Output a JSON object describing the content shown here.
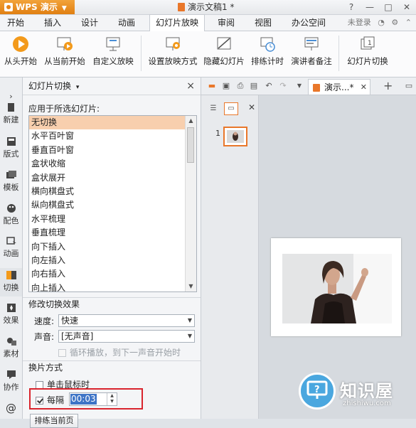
{
  "titlebar": {
    "app_name": "WPS 演示",
    "doc_title": "演示文稿1 *",
    "controls": [
      "?",
      "—",
      "□",
      "✕"
    ]
  },
  "menu": {
    "tabs": [
      "开始",
      "插入",
      "设计",
      "动画",
      "幻灯片放映",
      "审阅",
      "视图",
      "办公空间"
    ],
    "active": "幻灯片放映",
    "login": "未登录"
  },
  "ribbon": {
    "buttons": [
      "从头开始",
      "从当前开始",
      "自定义放映",
      "设置放映方式",
      "隐藏幻灯片",
      "排练计时",
      "演讲者备注",
      "幻灯片切换"
    ]
  },
  "left_toolbar": {
    "items": [
      "新建",
      "版式",
      "模板",
      "配色",
      "动画",
      "切换",
      "效果",
      "素材",
      "协作",
      "@"
    ],
    "active": "切换"
  },
  "pane": {
    "title": "幻灯片切换",
    "apply_label": "应用于所选幻灯片:",
    "transitions": [
      "无切换",
      "水平百叶窗",
      "垂直百叶窗",
      "盒状收缩",
      "盒状展开",
      "横向棋盘式",
      "纵向棋盘式",
      "水平梳理",
      "垂直梳理",
      "向下插入",
      "向左插入",
      "向右插入",
      "向上插入"
    ],
    "selected": "无切换",
    "modify_label": "修改切换效果",
    "speed_label": "速度:",
    "speed_value": "快速",
    "sound_label": "声音:",
    "sound_value": "[无声音]",
    "loop_label": "循环播放，到下一声音开始时",
    "advance_label": "换片方式",
    "on_click_label": "单击鼠标时",
    "every_label": "每隔",
    "every_value": "00:03",
    "partial_button": "排练当前页"
  },
  "doc_tab": {
    "label": "演示...*"
  },
  "thumbnails": {
    "slide_number": "1"
  },
  "watermark": {
    "title": "知识屋",
    "subtitle": "zhishiwu.com"
  },
  "colors": {
    "accent": "#e9772a",
    "selection": "#f8cfae",
    "highlight_box": "#d9242d",
    "spin_selection": "#3d74c6"
  }
}
